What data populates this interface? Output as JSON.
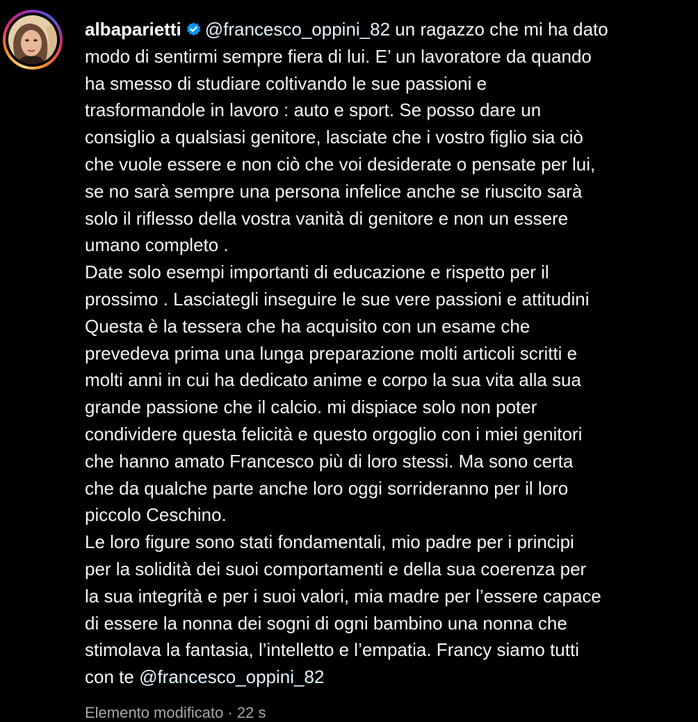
{
  "post": {
    "username": "albaparietti",
    "verified_icon": "verified-badge-icon",
    "mention_start": "@francesco_oppini_82",
    "first_line_rest": " un ragazzo che mi ha dato",
    "lines": [
      "modo di sentirmi sempre fiera di lui. E’ un lavoratore da quando",
      "ha smesso di studiare coltivando le sue passioni e",
      "trasformandole in lavoro : auto e sport. Se posso dare un",
      "consiglio a qualsiasi genitore, lasciate che i vostro figlio sia ciò",
      "che vuole essere e non ciò che voi desiderate o pensate per lui,",
      "se no sarà sempre una persona infelice anche se riuscito sarà",
      "solo il riflesso della vostra vanità di genitore e non un essere",
      "umano completo .",
      "Date solo esempi importanti di educazione e rispetto per il",
      "prossimo . Lasciategli inseguire le sue vere passioni e attitudini",
      "Questa è la tessera che ha acquisito con un esame che",
      "prevedeva prima una lunga preparazione molti articoli scritti e",
      "molti anni in cui ha dedicato anime e corpo la sua vita alla sua",
      "grande passione che il calcio. mi dispiace solo non poter",
      "condividere questa felicità e questo orgoglio con i miei genitori",
      "che hanno amato Francesco più di loro stessi. Ma sono certa",
      "che da qualche parte anche loro oggi sorrideranno per il loro",
      "piccolo Ceschino.",
      "Le loro figure sono stati fondamentali, mio padre per i principi",
      "per la solidità dei suoi comportamenti e della sua coerenza per",
      "la sua integrità e per i suoi valori, mia madre per l’essere capace",
      "di essere la nonna dei sogni di ogni bambino una nonna che",
      "stimolava la fantasia, l’intelletto e l’empatia. Francy siamo tutti"
    ],
    "last_line_prefix": "con te ",
    "mention_end": "@francesco_oppini_82",
    "footer_partial": "Elemento modificato · 22 s"
  },
  "colors": {
    "background": "#000000",
    "text": "#f5f5f5",
    "mention": "#e0f1ff",
    "verified": "#0095f6",
    "muted": "#a8a8a8"
  }
}
